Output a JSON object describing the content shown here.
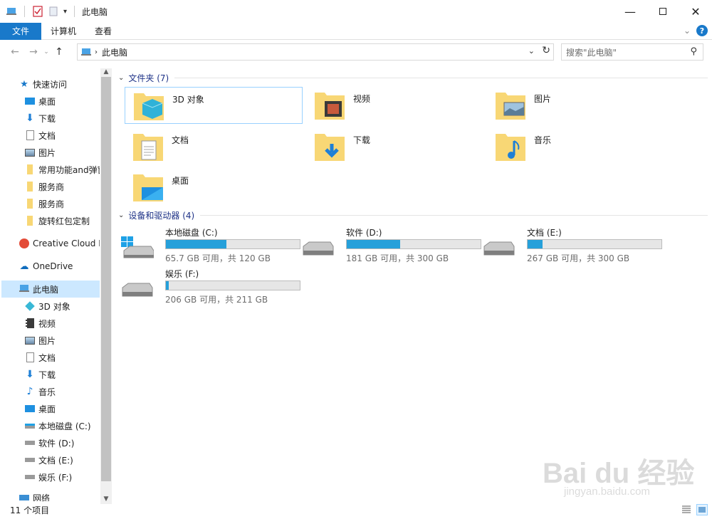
{
  "window": {
    "title": "此电脑",
    "controls": [
      "minimize",
      "maximize",
      "close"
    ]
  },
  "ribbon": {
    "tabs": [
      "文件",
      "计算机",
      "查看"
    ],
    "help": "?"
  },
  "address": {
    "crumb": "此电脑",
    "search_placeholder": "搜索\"此电脑\""
  },
  "nav": {
    "quick_access": "快速访问",
    "quick_items": [
      {
        "label": "桌面",
        "icon": "desktop-icon",
        "pinned": true
      },
      {
        "label": "下载",
        "icon": "download-icon",
        "pinned": true
      },
      {
        "label": "文档",
        "icon": "document-icon",
        "pinned": true
      },
      {
        "label": "图片",
        "icon": "picture-icon",
        "pinned": true
      },
      {
        "label": "常用功能and弹窗",
        "icon": "folder-icon",
        "pinned": false
      },
      {
        "label": "服务商",
        "icon": "folder-icon",
        "pinned": false
      },
      {
        "label": "服务商",
        "icon": "folder-icon",
        "pinned": false
      },
      {
        "label": "旋转红包定制",
        "icon": "folder-icon",
        "pinned": false
      }
    ],
    "creative_cloud": "Creative Cloud Files",
    "onedrive": "OneDrive",
    "this_pc": "此电脑",
    "pc_items": [
      {
        "label": "3D 对象",
        "icon": "3d-objects-icon"
      },
      {
        "label": "视频",
        "icon": "video-icon"
      },
      {
        "label": "图片",
        "icon": "picture-icon"
      },
      {
        "label": "文档",
        "icon": "document-icon"
      },
      {
        "label": "下载",
        "icon": "download-icon"
      },
      {
        "label": "音乐",
        "icon": "music-icon"
      },
      {
        "label": "桌面",
        "icon": "desktop-icon"
      },
      {
        "label": "本地磁盘 (C:)",
        "icon": "drive-c-icon"
      },
      {
        "label": "软件 (D:)",
        "icon": "drive-icon"
      },
      {
        "label": "文档 (E:)",
        "icon": "drive-icon"
      },
      {
        "label": "娱乐 (F:)",
        "icon": "drive-icon"
      }
    ],
    "network": "网络"
  },
  "content": {
    "folders_header": "文件夹 (7)",
    "folders": [
      {
        "label": "3D 对象",
        "icon": "3d-objects-folder-icon"
      },
      {
        "label": "视频",
        "icon": "video-folder-icon"
      },
      {
        "label": "图片",
        "icon": "picture-folder-icon"
      },
      {
        "label": "文档",
        "icon": "document-folder-icon"
      },
      {
        "label": "下载",
        "icon": "download-folder-icon"
      },
      {
        "label": "音乐",
        "icon": "music-folder-icon"
      },
      {
        "label": "桌面",
        "icon": "desktop-folder-icon"
      }
    ],
    "drives_header": "设备和驱动器 (4)",
    "drives": [
      {
        "name": "本地磁盘 (C:)",
        "free": "65.7 GB 可用，共 120 GB",
        "used_fraction": 0.45,
        "windows": true
      },
      {
        "name": "软件 (D:)",
        "free": "181 GB 可用，共 300 GB",
        "used_fraction": 0.4,
        "windows": false
      },
      {
        "name": "文档 (E:)",
        "free": "267 GB 可用，共 300 GB",
        "used_fraction": 0.11,
        "windows": false
      },
      {
        "name": "娱乐 (F:)",
        "free": "206 GB 可用，共 211 GB",
        "used_fraction": 0.02,
        "windows": false
      }
    ]
  },
  "status": {
    "count": "11 个项目"
  },
  "watermark": {
    "big": "Bai du 经验",
    "small": "jingyan.baidu.com"
  },
  "colors": {
    "accent": "#1979ca",
    "selection": "#cce8ff",
    "drive_fill": "#26a0da",
    "folder": "#f8d775"
  }
}
